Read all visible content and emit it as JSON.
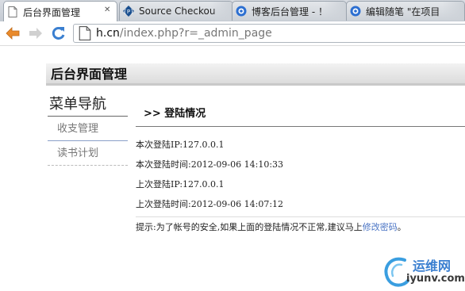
{
  "browser": {
    "tabs": [
      {
        "label": "后台界面管理",
        "icon": "page-icon",
        "active": true
      },
      {
        "label": "Source Checkou",
        "icon": "sourceforge-icon",
        "active": false
      },
      {
        "label": "博客后台管理 - ！",
        "icon": "blog-icon",
        "active": false
      },
      {
        "label": "编辑随笔 \"在项目",
        "icon": "blog-icon",
        "active": false
      }
    ],
    "url_host": "h.cn",
    "url_path": "/index.php?r=_admin_page"
  },
  "page": {
    "header_title": "后台界面管理",
    "sidebar": {
      "title": "菜单导航",
      "items": [
        {
          "label": "收支管理"
        },
        {
          "label": "读书计划"
        }
      ]
    },
    "main": {
      "section_title": ">> 登陆情况",
      "lines": [
        "本次登陆IP:127.0.0.1",
        "本次登陆时间:2012-09-06 14:10:33",
        "上次登陆IP:127.0.0.1",
        "上次登陆时间:2012-09-06 14:07:12"
      ],
      "hint_prefix": "提示:为了帐号的安全,如果上面的登陆情况不正常,建议马上",
      "hint_link": "修改密码",
      "hint_suffix": "。"
    }
  },
  "watermark": {
    "line1": "运维网",
    "line2": "iyunv.com"
  },
  "colors": {
    "accent": "#3a7fd0",
    "link": "#4a74c4",
    "header_bg": "#e4e4e4"
  }
}
